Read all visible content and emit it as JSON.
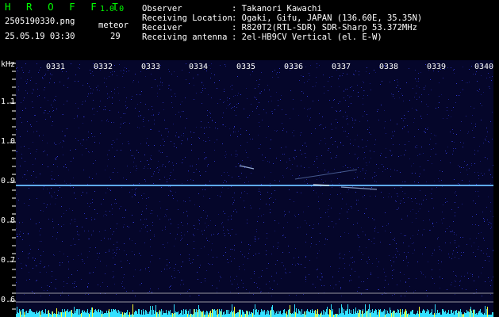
{
  "app": {
    "brand": "H R O F F T",
    "version": "1.0.0"
  },
  "file": {
    "name": "2505190330.png",
    "datetime": "25.05.19 03:30"
  },
  "meteor": {
    "label": "meteor",
    "count": "29"
  },
  "info": [
    {
      "label": "Observer",
      "value": ": Takanori Kawachi"
    },
    {
      "label": "Receiving Location",
      "value": ": Ogaki, Gifu, JAPAN (136.60E, 35.35N)"
    },
    {
      "label": "Receiver",
      "value": ": R820T2(RTL-SDR) SDR-Sharp 53.372MHz"
    },
    {
      "label": "Receiving antenna",
      "value": ": 2el-HB9CV Vertical (el. E-W)"
    }
  ],
  "axis": {
    "unit": "kHz",
    "y_ticks": [
      "1.1",
      "1.0",
      "0.9",
      "0.8",
      "0.7",
      "0.6"
    ],
    "x_ticks": [
      "0331",
      "0332",
      "0333",
      "0334",
      "0335",
      "0336",
      "0337",
      "0338",
      "0339",
      "0340"
    ]
  },
  "colors": {
    "background": "#000000",
    "spectrogram_bg": "#05062a",
    "carrier": "#4ea0ff",
    "meteor_trace": "#b8d4ff",
    "header_green": "#00ff00",
    "level_cyan": "#33e0ff",
    "level_yellow": "#ffff33"
  }
}
